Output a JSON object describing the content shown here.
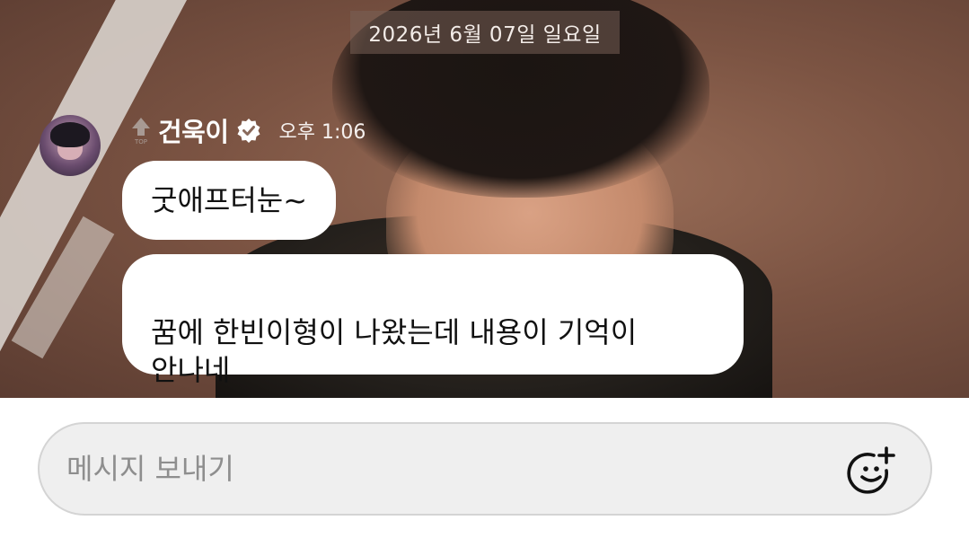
{
  "chat": {
    "date_separator": "2026년 6월 07일 일요일",
    "sender": {
      "name": "건욱이",
      "rank_badge_icon": "top-rank-arrow-icon",
      "verified_icon": "verified-check-icon",
      "time": "오후 1:06"
    },
    "messages": [
      {
        "text": "굿애프터눈~"
      },
      {
        "text": "꿈에 한빈이형이 나왔는데 내용이 기억이\n안나네"
      }
    ]
  },
  "composer": {
    "placeholder": "메시지 보내기",
    "emoji_button_icon": "add-emoji-icon"
  },
  "colors": {
    "bubble_bg": "#ffffff",
    "input_bg": "#efefef",
    "input_border": "#d4d4d4",
    "date_chip_bg": "#786056"
  }
}
